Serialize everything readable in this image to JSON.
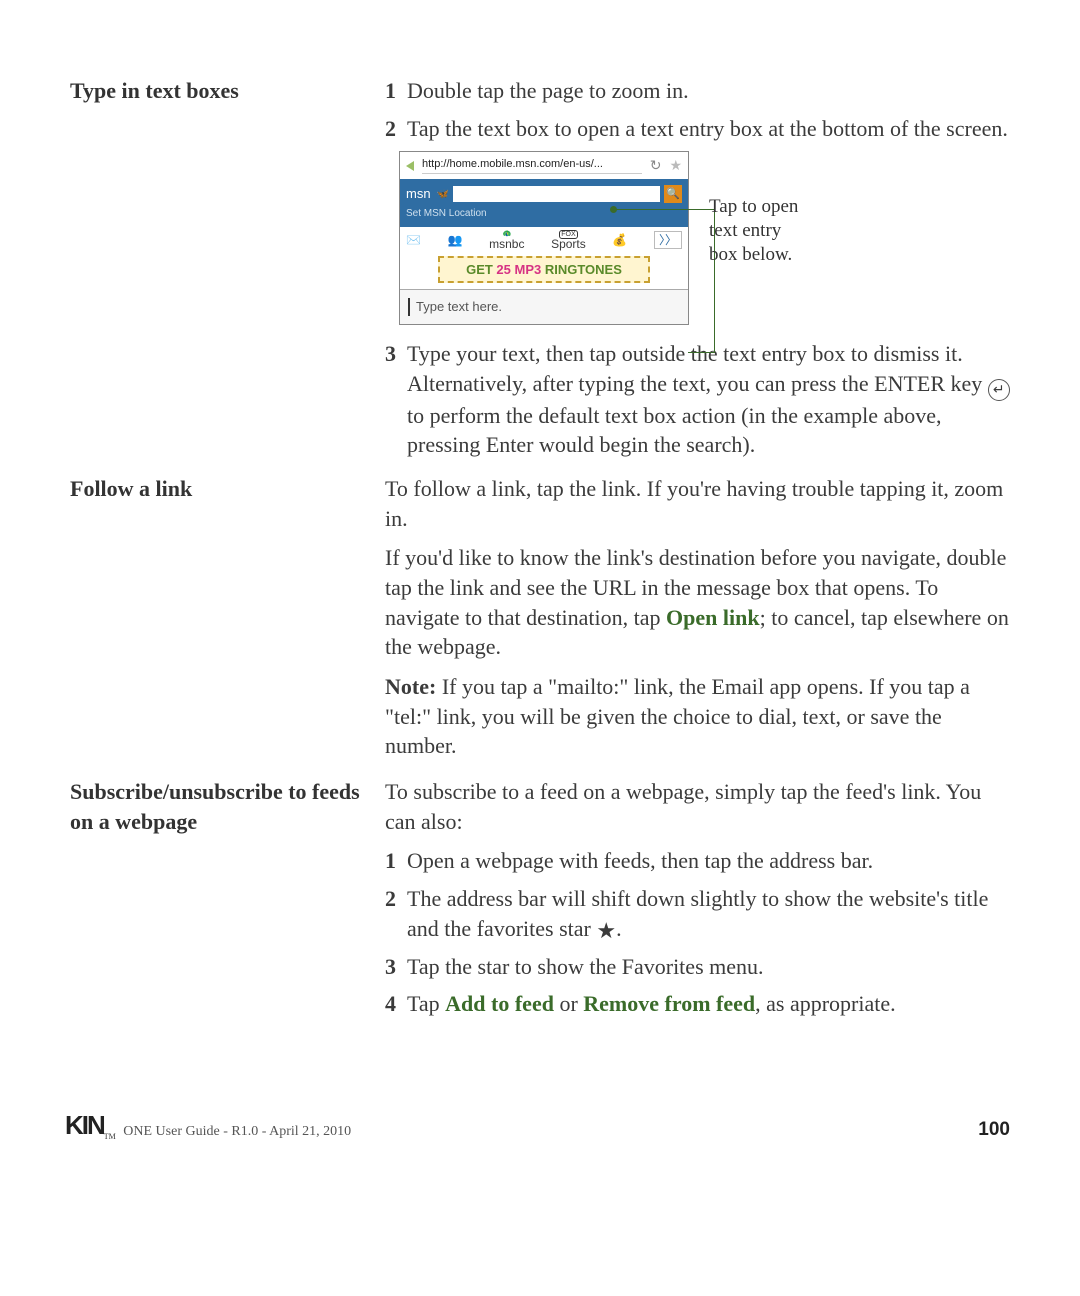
{
  "sections": {
    "type_boxes": {
      "heading": "Type in text boxes",
      "step1_num": "1",
      "step1": "Double tap the page to zoom in.",
      "step2_num": "2",
      "step2": "Tap the text box to open a text entry box at the bottom of the screen.",
      "step3_num": "3",
      "step3a": "Type your text, then tap outside the text entry box to dismiss it. Alternatively, after typing the text, you can press the ENTER key ",
      "step3b": " to perform the default text box action (in the example above, pressing Enter would begin the search)."
    },
    "follow_link": {
      "heading": "Follow a link",
      "p1": "To follow a link, tap the link. If you're having trouble tapping it, zoom in.",
      "p2a": "If you'd like to know the link's destination before you navigate, double tap the link and see the URL in the message box that opens. To navigate to that destination, tap ",
      "open_link": "Open link",
      "p2b": "; to cancel, tap elsewhere on the webpage.",
      "note_label": "Note:",
      "note_body": " If you tap a \"mailto:\" link, the Email app opens. If you tap a \"tel:\" link, you will be given the choice to dial, text, or save the number."
    },
    "feeds": {
      "heading": "Subscribe/unsubscribe to feeds on a webpage",
      "intro": "To subscribe to a feed on a webpage, simply tap the feed's link. You can also:",
      "s1_num": "1",
      "s1": "Open a webpage with feeds, then tap the address bar.",
      "s2_num": "2",
      "s2a": "The address bar will shift down slightly to show the website's title and the favorites star ",
      "s2b": ".",
      "s3_num": "3",
      "s3": "Tap the star to show the Favorites menu.",
      "s4_num": "4",
      "s4a": "Tap ",
      "add_feed": "Add to feed",
      "s4b": " or ",
      "remove_feed": "Remove from feed",
      "s4c": ", as appropriate."
    }
  },
  "mock": {
    "url": "http://home.mobile.msn.com/en-us/...",
    "msn_label": "msn",
    "search_glyph": "🔍",
    "set_location": "Set MSN Location",
    "icon_msnbc": "msnbc",
    "icon_sports": "Sports",
    "ad_text_pre": "GET ",
    "ad_text_num": "25 ",
    "ad_text_mp3": "MP3 ",
    "ad_text_ring": "RINGTONES",
    "type_here": "Type text here.",
    "callout": "Tap to open text entry box below.",
    "enter_glyph": "↵",
    "star_glyph": "★",
    "refresh_glyph": "↻",
    "favstar_glyph": "★",
    "more_glyph": "〉〉"
  },
  "footer": {
    "logo": "KIN",
    "tm": "TM",
    "text": " ONE User Guide - R1.0 - April 21, 2010",
    "page": "100"
  }
}
